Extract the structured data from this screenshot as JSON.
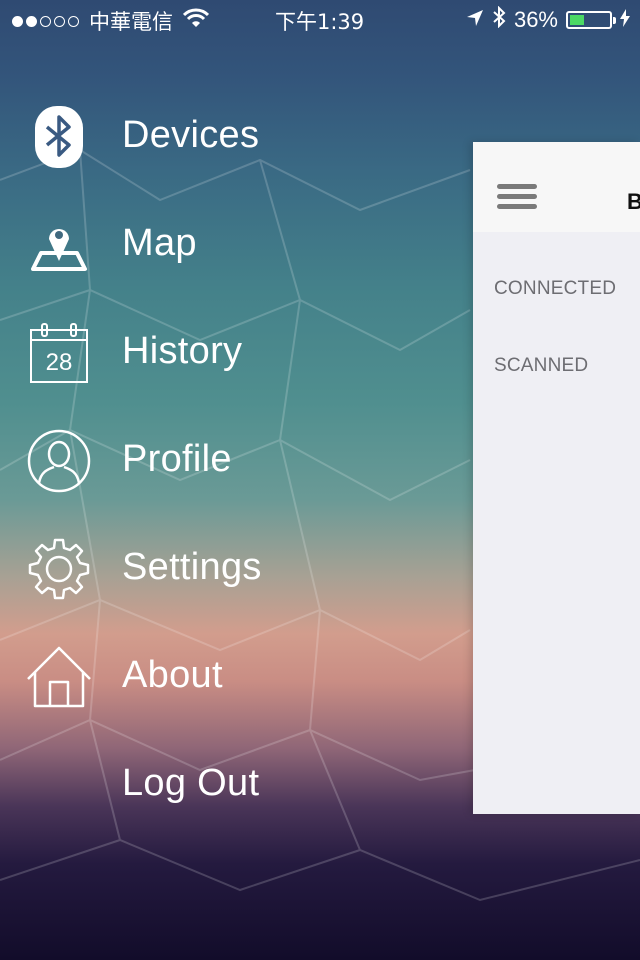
{
  "status_bar": {
    "carrier": "中華電信",
    "time": "下午1:39",
    "battery_percent": "36%",
    "battery_level": 0.36,
    "signal_bars_filled": 2,
    "signal_bars_total": 5,
    "icons": [
      "wifi-icon",
      "location-arrow-icon",
      "bluetooth-icon",
      "battery-icon",
      "charging-icon"
    ]
  },
  "menu": {
    "items": [
      {
        "label": "Devices",
        "icon": "bluetooth-icon"
      },
      {
        "label": "Map",
        "icon": "map-pin-icon"
      },
      {
        "label": "History",
        "icon": "calendar-icon",
        "icon_text": "28"
      },
      {
        "label": "Profile",
        "icon": "user-icon"
      },
      {
        "label": "Settings",
        "icon": "gear-icon"
      },
      {
        "label": "About",
        "icon": "house-icon"
      },
      {
        "label": "Log Out",
        "icon": ""
      }
    ]
  },
  "main": {
    "title": "B",
    "sections": [
      "CONNECTED",
      "SCANNED"
    ]
  },
  "colors": {
    "menu_text": "#ffffff",
    "panel_background": "#efeff4",
    "navbar_background": "#f7f7f7",
    "battery_fill": "#4cd964",
    "section_header": "#6d6d72"
  }
}
